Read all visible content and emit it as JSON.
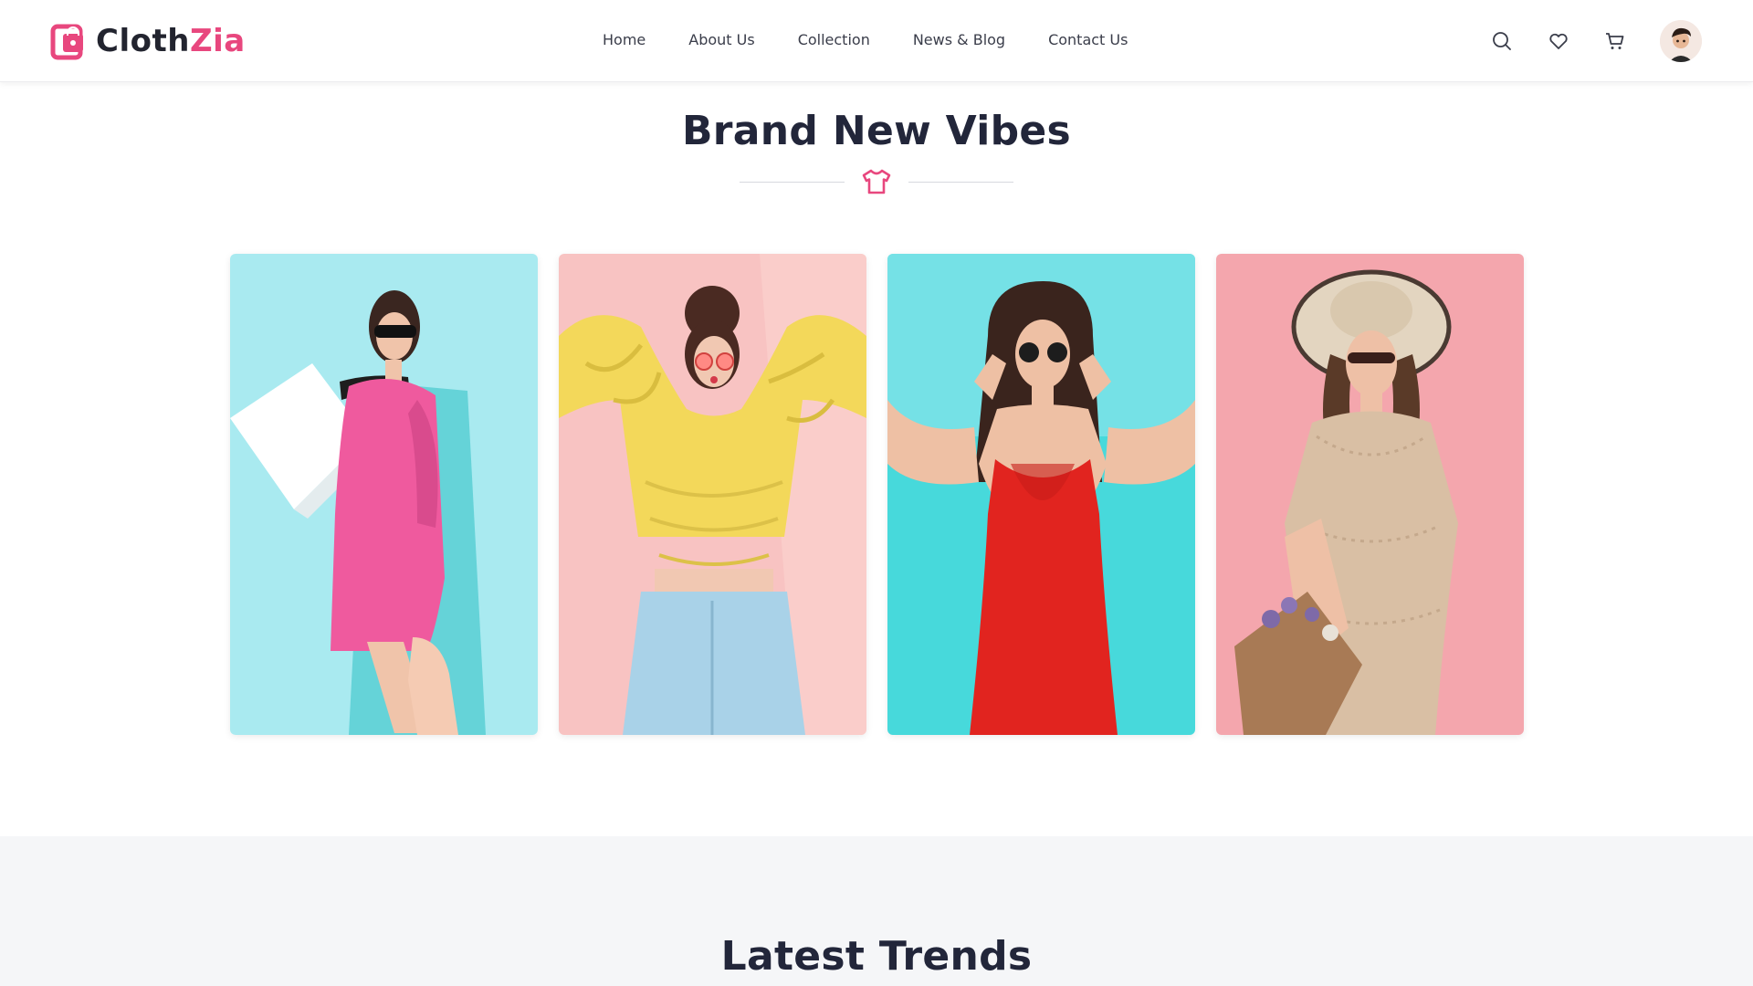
{
  "brand": {
    "name_part1": "Cloth",
    "name_part2": "Zia",
    "accent_color": "#e8477e"
  },
  "nav": {
    "items": [
      {
        "label": "Home"
      },
      {
        "label": "About Us"
      },
      {
        "label": "Collection"
      },
      {
        "label": "News & Blog"
      },
      {
        "label": "Contact Us"
      }
    ]
  },
  "header_icons": [
    "search-icon",
    "heart-icon",
    "cart-icon",
    "avatar"
  ],
  "section1": {
    "title": "Brand New Vibes",
    "divider_icon": "tshirt-icon",
    "cards": [
      {
        "bg": "#a9eaf0",
        "outfit": "#ef5a9e"
      },
      {
        "bg": "#f8b9bb",
        "outfit": "#f3d85a"
      },
      {
        "bg": "#39d3d6",
        "outfit": "#e1241f"
      },
      {
        "bg": "#f4a6ad",
        "outfit": "#d9bfa4"
      }
    ]
  },
  "section2": {
    "title": "Latest Trends"
  }
}
